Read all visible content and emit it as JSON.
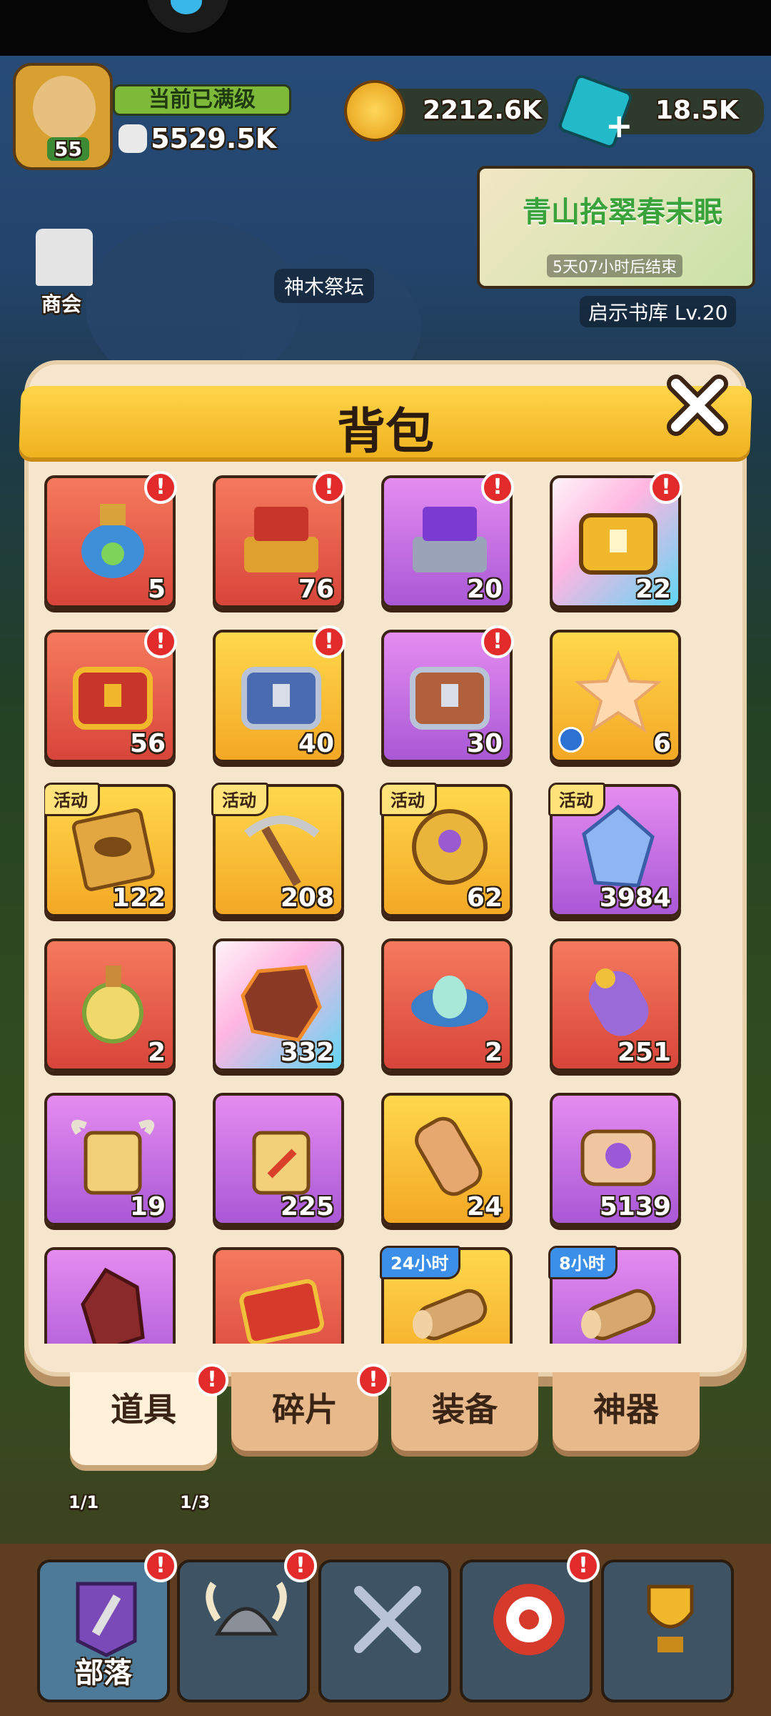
{
  "hud": {
    "level": "55",
    "level_status": "当前已满级",
    "power": "5529.5K",
    "coins": "2212.6K",
    "gems": "18.5K",
    "event_title": "青山拾翠春末眠",
    "event_time": "5天07小时后结束",
    "shop_label": "商会",
    "altar_label": "神木祭坛",
    "library_label": "启示书库 Lv.20"
  },
  "panel": {
    "title": "背包",
    "close_icon": "close-icon"
  },
  "items": [
    {
      "icon": "potion-vase-icon",
      "count": "5",
      "bg": "red",
      "alert": true
    },
    {
      "icon": "red-book-chest-icon",
      "count": "76",
      "bg": "red",
      "alert": true
    },
    {
      "icon": "purple-book-chest-icon",
      "count": "20",
      "bg": "purple",
      "alert": true
    },
    {
      "icon": "golden-chest-icon",
      "count": "22",
      "bg": "cyan",
      "alert": true
    },
    {
      "icon": "red-gold-chest-icon",
      "count": "56",
      "bg": "red",
      "alert": true
    },
    {
      "icon": "blue-chest-icon",
      "count": "40",
      "bg": "gold",
      "alert": true
    },
    {
      "icon": "brown-chest-icon",
      "count": "30",
      "bg": "purple",
      "alert": true
    },
    {
      "icon": "star-icon",
      "count": "6",
      "bg": "gold",
      "alert": false,
      "clock": true
    },
    {
      "icon": "tablet-icon",
      "count": "122",
      "bg": "gold",
      "tag": "活动"
    },
    {
      "icon": "pickaxe-icon",
      "count": "208",
      "bg": "gold",
      "tag": "活动"
    },
    {
      "icon": "coin-icon",
      "count": "62",
      "bg": "gold",
      "tag": "活动"
    },
    {
      "icon": "crystal-icon",
      "count": "3984",
      "bg": "purple",
      "tag": "活动"
    },
    {
      "icon": "elixir-bottle-icon",
      "count": "2",
      "bg": "red"
    },
    {
      "icon": "lava-rock-icon",
      "count": "332",
      "bg": "cyan"
    },
    {
      "icon": "lotus-icon",
      "count": "2",
      "bg": "red"
    },
    {
      "icon": "purple-scroll-icon",
      "count": "251",
      "bg": "red"
    },
    {
      "icon": "horned-scroll-icon",
      "count": "19",
      "bg": "purple"
    },
    {
      "icon": "horned-sword-scroll-icon",
      "count": "225",
      "bg": "purple"
    },
    {
      "icon": "rolled-scroll-icon",
      "count": "24",
      "bg": "gold"
    },
    {
      "icon": "magic-scroll-icon",
      "count": "5139",
      "bg": "purple"
    },
    {
      "icon": "red-gem-icon",
      "count": "",
      "bg": "purple"
    },
    {
      "icon": "red-card-icon",
      "count": "",
      "bg": "red"
    },
    {
      "icon": "wood-log-icon",
      "count": "",
      "bg": "gold",
      "tag": "24小时",
      "tag_style": "blue"
    },
    {
      "icon": "wood-log-icon",
      "count": "",
      "bg": "purple",
      "tag": "8小时",
      "tag_style": "blue"
    }
  ],
  "tabs": [
    {
      "label": "道具",
      "active": true,
      "alert": true
    },
    {
      "label": "碎片",
      "active": false,
      "alert": true
    },
    {
      "label": "装备",
      "active": false,
      "alert": false
    },
    {
      "label": "神器",
      "active": false,
      "alert": false
    }
  ],
  "side_counters": [
    "1/1",
    "1/3"
  ],
  "bottom_nav": [
    {
      "name": "tribe",
      "label": "部落",
      "icon": "sword-banner-icon",
      "alert": true
    },
    {
      "name": "hero",
      "label": "",
      "icon": "viking-helmet-icon",
      "alert": true
    },
    {
      "name": "battle",
      "label": "",
      "icon": "crossed-swords-icon",
      "alert": false
    },
    {
      "name": "target",
      "label": "",
      "icon": "target-icon",
      "alert": true
    },
    {
      "name": "trophy",
      "label": "",
      "icon": "trophy-icon",
      "alert": false
    }
  ]
}
